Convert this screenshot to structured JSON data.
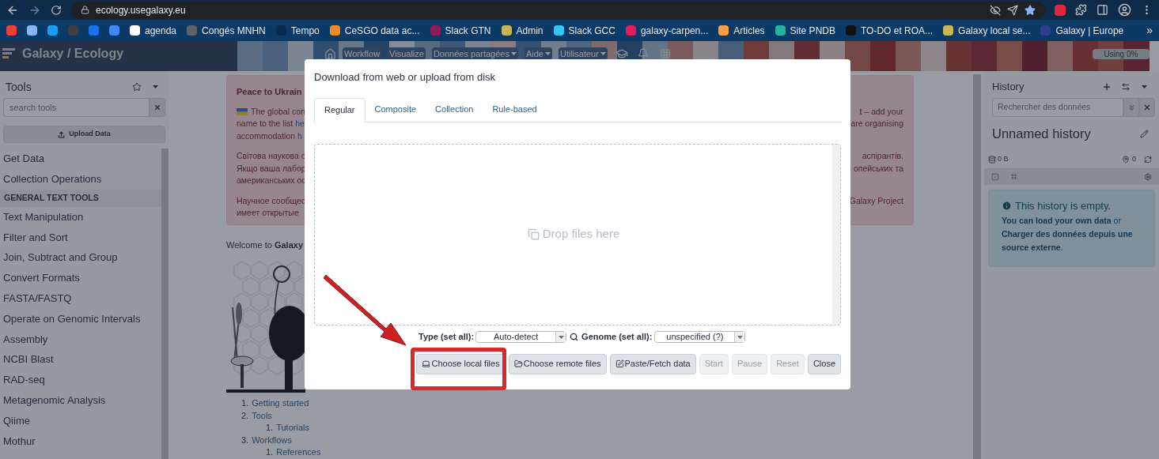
{
  "browser": {
    "url": "ecology.usegalaxy.eu",
    "bookmarks": [
      {
        "color": "#ea4335"
      },
      {
        "color": "#8ab4f8"
      },
      {
        "color": "#1d9bf0"
      },
      {
        "color": "#3c4043"
      },
      {
        "color": "#1a73e8"
      },
      {
        "color": "#4285f4"
      },
      {
        "label": "agenda",
        "color": "#ffffff"
      },
      {
        "label": "Congés MNHN",
        "color": "#5f6368"
      },
      {
        "label": "Tempo",
        "color": "#0b2a4a"
      },
      {
        "label": "CeSGO data ac...",
        "color": "#f28c28"
      },
      {
        "label": "Slack GTN",
        "color": "#8b1d5a"
      },
      {
        "label": "Admin",
        "color": "#c9b458"
      },
      {
        "label": "Slack GCC",
        "color": "#36c5f0"
      },
      {
        "label": "galaxy-carpen...",
        "color": "#e01e5a"
      },
      {
        "label": "Articles",
        "color": "#f6a04d"
      },
      {
        "label": "Site PNDB",
        "color": "#2bb0a0"
      },
      {
        "label": "TO-DO et ROA...",
        "color": "#111111"
      },
      {
        "label": "Galaxy local se...",
        "color": "#c9b458"
      },
      {
        "label": "Galaxy | Europe",
        "color": "#2c3e8c"
      }
    ],
    "more": "»"
  },
  "header": {
    "brand": "Galaxy / Ecology",
    "nav": [
      {
        "label": "Workflow",
        "menu": false
      },
      {
        "label": "Visualize",
        "menu": false
      },
      {
        "label": "Données partagées",
        "menu": true
      },
      {
        "label": "Aide",
        "menu": true
      },
      {
        "label": "Utilisateur",
        "menu": true
      }
    ],
    "quota": {
      "label": "Using 0%",
      "level": 0
    }
  },
  "tools": {
    "title": "Tools",
    "search": {
      "placeholder": "search tools"
    },
    "upload": "Upload Data",
    "items": [
      {
        "kind": "section",
        "label": "Get Data"
      },
      {
        "kind": "section",
        "label": "Collection Operations"
      },
      {
        "kind": "header",
        "label": "GENERAL TEXT TOOLS"
      },
      {
        "kind": "section",
        "label": "Text Manipulation"
      },
      {
        "kind": "section",
        "label": "Filter and Sort"
      },
      {
        "kind": "section",
        "label": "Join, Subtract and Group"
      },
      {
        "kind": "section",
        "label": "Convert Formats"
      },
      {
        "kind": "section",
        "label": "FASTA/FASTQ"
      },
      {
        "kind": "section",
        "label": "Operate on Genomic Intervals"
      },
      {
        "kind": "section",
        "label": "Assembly"
      },
      {
        "kind": "section",
        "label": "NCBI Blast"
      },
      {
        "kind": "section",
        "label": "RAD-seq"
      },
      {
        "kind": "section",
        "label": "Metagenomic Analysis"
      },
      {
        "kind": "section",
        "label": "Qiime"
      },
      {
        "kind": "section",
        "label": "Mothur"
      }
    ]
  },
  "center": {
    "alert": {
      "title": "Peace to Ukrain",
      "paragraphs": [
        {
          "left": [
            {
              "text": "The global con",
              "flag": true
            },
            {
              "text": "name to the list ",
              "link": "he"
            },
            {
              "text": "accommodation ",
              "link": "h"
            }
          ],
          "right": [
            "t – add your",
            "are organising"
          ]
        },
        {
          "left": [
            {
              "text": "Світова наукова с"
            },
            {
              "text": "Якщо ваша лабор"
            },
            {
              "text": "американських ос"
            }
          ],
          "right": [
            "аспірантів.",
            "опейських та"
          ]
        },
        {
          "left": [
            {
              "text": "Научное сообщес"
            },
            {
              "text": "имеет открытые"
            }
          ],
          "right": [
            "Galaxy Project"
          ]
        }
      ]
    },
    "welcome": "Welcome to **Galaxy**",
    "links": [
      {
        "number": "1.",
        "label": "Getting started"
      },
      {
        "number": "2.",
        "label": "Tools",
        "children": [
          {
            "number": "1.",
            "label": "Tutorials"
          }
        ]
      },
      {
        "number": "3.",
        "label": "Workflows",
        "children": [
          {
            "number": "1.",
            "label": "References"
          }
        ]
      }
    ]
  },
  "history": {
    "title": "History",
    "search": {
      "placeholder": "Rechercher des données"
    },
    "name": "Unnamed history",
    "size": "0 B",
    "count": "0",
    "empty": {
      "title": "This history is empty.",
      "text": "**You can load your own data** or **Charger des données depuis une source externe**."
    }
  },
  "modal": {
    "title": "Download from web or upload from disk",
    "tabs": [
      {
        "label": "Regular",
        "selected": true
      },
      {
        "label": "Composite",
        "selected": false
      },
      {
        "label": "Collection",
        "selected": false
      },
      {
        "label": "Rule-based",
        "selected": false
      }
    ],
    "dropzone": "Drop files here",
    "type_label": "Type (set all):",
    "type_value": "Auto-detect",
    "genome_label": "Genome (set all):",
    "genome_value": "unspecified (?)",
    "buttons": [
      {
        "kind": "local",
        "label": "Choose local files",
        "disabled": false
      },
      {
        "kind": "remote",
        "label": "Choose remote files",
        "disabled": false
      },
      {
        "kind": "paste",
        "label": "Paste/Fetch data",
        "disabled": false
      },
      {
        "kind": "plain",
        "label": "Start",
        "disabled": true
      },
      {
        "kind": "plain",
        "label": "Pause",
        "disabled": true
      },
      {
        "kind": "plain",
        "label": "Reset",
        "disabled": true
      },
      {
        "kind": "plain",
        "label": "Close",
        "disabled": false
      }
    ]
  }
}
